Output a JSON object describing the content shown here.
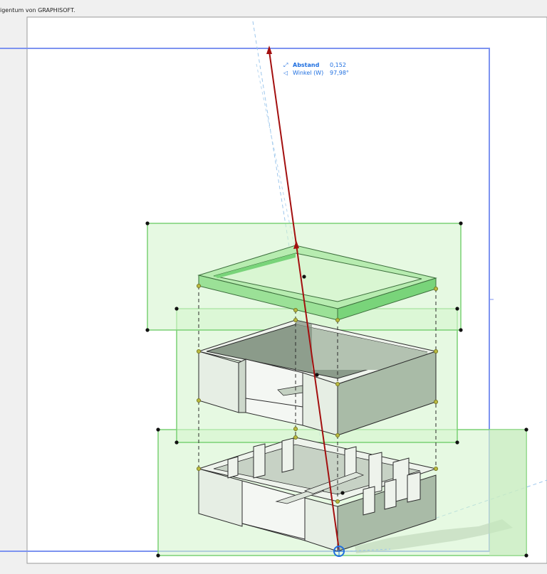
{
  "header": {
    "caption": "igentum von GRAPHISOFT."
  },
  "readout": {
    "distance_icon": "distance-arrow-icon",
    "distance_label": "Abstand",
    "distance_value": "0,152",
    "angle_icon": "angle-icon",
    "angle_label": "Winkel (W)",
    "angle_value": "97,98°"
  },
  "colors": {
    "selection_fill": "#d6f5cf",
    "selection_edge": "#7ad174",
    "roof_green": "#79d47a",
    "wall_face": "#e6eee4",
    "wall_shade": "#a9bba7",
    "vector_red": "#a30f0f",
    "boundary_blue": "#7d93f0",
    "readout_blue": "#1f6fe0",
    "hotspot_olive": "#9a9a25"
  }
}
